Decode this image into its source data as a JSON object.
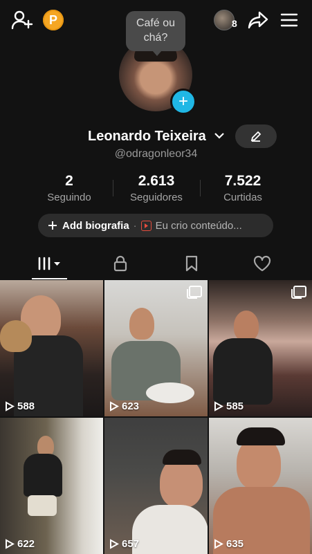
{
  "header": {
    "coin_label": "P",
    "bubble_text": "Café ou chá?",
    "friends_count": "8"
  },
  "profile": {
    "name": "Leonardo Teixeira",
    "handle": "@odragonleor34"
  },
  "stats": [
    {
      "value": "2",
      "label": "Seguindo"
    },
    {
      "value": "2.613",
      "label": "Seguidores"
    },
    {
      "value": "7.522",
      "label": "Curtidas"
    }
  ],
  "bio": {
    "add_label": "Add biografia",
    "separator": "·",
    "creator_label": "Eu crio conteúdo..."
  },
  "tabs": [
    "videos-grid-icon",
    "lock-icon",
    "bookmark-icon",
    "heart-icon"
  ],
  "videos": [
    {
      "views": "588"
    },
    {
      "views": "623"
    },
    {
      "views": "585"
    },
    {
      "views": "622"
    },
    {
      "views": "657"
    },
    {
      "views": "635"
    }
  ],
  "colors": {
    "background": "#121212",
    "accent_blue": "#20b7e5",
    "coin": "#f5a623",
    "creator_icon": "#e64d3d"
  }
}
